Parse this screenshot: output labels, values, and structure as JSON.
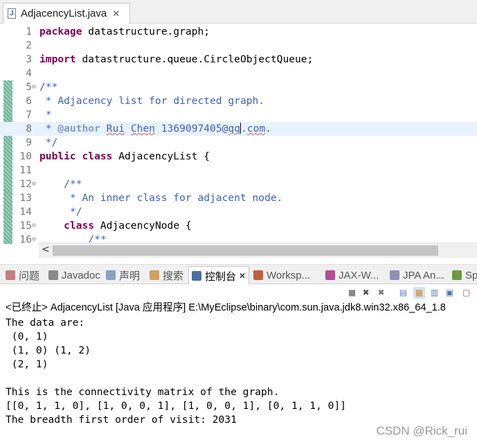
{
  "editor": {
    "tab_label": "AdjacencyList.java",
    "close_glyph": "✕",
    "file_icon_letter": "J",
    "lines": [
      {
        "n": "1",
        "fold": "",
        "segments": [
          [
            "kw",
            "package"
          ],
          [
            "",
            "datastructure.graph;"
          ]
        ]
      },
      {
        "n": "2",
        "fold": "",
        "segments": []
      },
      {
        "n": "3",
        "fold": "",
        "segments": [
          [
            "kw",
            "import"
          ],
          [
            "",
            "datastructure.queue.CircleObjectQueue;"
          ]
        ]
      },
      {
        "n": "4",
        "fold": "",
        "segments": []
      },
      {
        "n": "5",
        "fold": "⊖",
        "segments": [
          [
            "cm",
            "/**"
          ]
        ]
      },
      {
        "n": "6",
        "fold": "",
        "segments": [
          [
            "cm",
            " * Adjacency list for directed graph."
          ]
        ]
      },
      {
        "n": "7",
        "fold": "",
        "segments": [
          [
            "cm",
            " *"
          ]
        ]
      },
      {
        "n": "8",
        "fold": "",
        "current": true,
        "segments": [
          [
            "cm",
            " * "
          ],
          [
            "tag",
            "@author"
          ],
          [
            "cm",
            " "
          ],
          [
            "cmw",
            "Rui"
          ],
          [
            "cm",
            " "
          ],
          [
            "cmw",
            "Chen"
          ],
          [
            "cm",
            " 1369097405@"
          ],
          [
            "cmw",
            "qq"
          ],
          [
            "caret",
            ""
          ],
          [
            "cm",
            "."
          ],
          [
            "cmw",
            "com"
          ],
          [
            "cm",
            "."
          ]
        ]
      },
      {
        "n": "9",
        "fold": "",
        "segments": [
          [
            "cm",
            " */"
          ]
        ]
      },
      {
        "n": "10",
        "fold": "",
        "segments": [
          [
            "kw",
            "public"
          ],
          [
            "",
            ""
          ],
          [
            "kw",
            "class"
          ],
          [
            "",
            "AdjacencyList {"
          ]
        ]
      },
      {
        "n": "11",
        "fold": "",
        "segments": []
      },
      {
        "n": "12",
        "fold": "⊖",
        "segments": [
          [
            "cm",
            "    /**"
          ]
        ]
      },
      {
        "n": "13",
        "fold": "",
        "segments": [
          [
            "cm",
            "     * An inner class for adjacent node."
          ]
        ]
      },
      {
        "n": "14",
        "fold": "",
        "segments": [
          [
            "cm",
            "     */"
          ]
        ]
      },
      {
        "n": "15",
        "fold": "⊖",
        "segments": [
          [
            "",
            "    "
          ],
          [
            "kw",
            "class"
          ],
          [
            "",
            "AdjacencyNode {"
          ]
        ]
      },
      {
        "n": "16",
        "fold": "⊖",
        "segments": [
          [
            "cm",
            "        /**"
          ]
        ]
      }
    ],
    "scroll_left_glyph": "<"
  },
  "views": {
    "tabs": [
      {
        "label": "问题",
        "icon": "problems-icon",
        "color": "#c08080"
      },
      {
        "label": "Javadoc",
        "icon": "javadoc-icon",
        "color": "#8a8a8a"
      },
      {
        "label": "声明",
        "icon": "declaration-icon",
        "color": "#8aa0c0"
      },
      {
        "label": "搜索",
        "icon": "search-icon",
        "color": "#d0a060"
      },
      {
        "label": "控制台",
        "icon": "console-icon",
        "color": "#4a6fa5"
      },
      {
        "label": "Worksp...",
        "icon": "workspace-icon",
        "color": "#c06040"
      },
      {
        "label": "JAX-W...",
        "icon": "jaxws-icon",
        "color": "#b05090"
      },
      {
        "label": "JPA An...",
        "icon": "jpa-icon",
        "color": "#9090b0"
      },
      {
        "label": "Sp",
        "icon": "spring-icon",
        "color": "#6a9a40"
      }
    ],
    "console_close_glyph": "✕"
  },
  "console": {
    "header": "<已终止> AdjacencyList [Java 应用程序] E:\\MyEclipse\\binary\\com.sun.java.jdk8.win32.x86_64_1.8",
    "output": [
      "The data are:",
      " (0, 1)",
      " (1, 0) (1, 2)",
      " (2, 1)",
      "",
      "This is the connectivity matrix of the graph.",
      "[[0, 1, 1, 0], [1, 0, 0, 1], [1, 0, 0, 1], [0, 1, 1, 0]]",
      "The breadth first order of visit: 2031"
    ],
    "toolbar_icons": [
      "terminate-icon",
      "remove-launch-icon",
      "remove-all-icon",
      "clear-console-icon",
      "scroll-lock-icon",
      "word-wrap-icon",
      "pin-console-icon",
      "display-console-icon"
    ]
  },
  "watermark": "CSDN @Rick_rui"
}
